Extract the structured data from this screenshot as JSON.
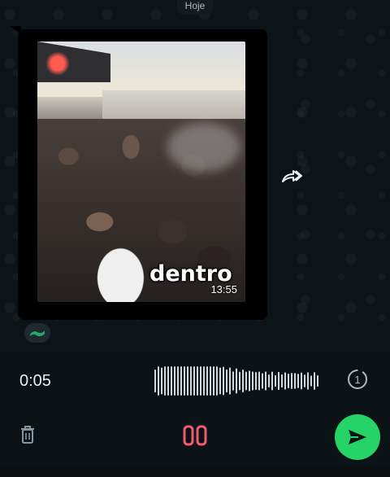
{
  "chat": {
    "date_label": "Hoje",
    "video_message": {
      "caption_overlay": "dentro",
      "duration": "13:55"
    }
  },
  "recorder": {
    "elapsed": "0:05",
    "pause_label": "00",
    "view_once_label": "1"
  },
  "colors": {
    "send_green": "#25d366",
    "pause_red": "#f15c6d",
    "background": "#0c1317"
  },
  "icons": {
    "forward": "forward-icon",
    "trash": "trash-icon",
    "pause": "pause-icon",
    "send": "send-icon",
    "view_once": "view-once-icon",
    "reaction": "reaction-icon"
  }
}
